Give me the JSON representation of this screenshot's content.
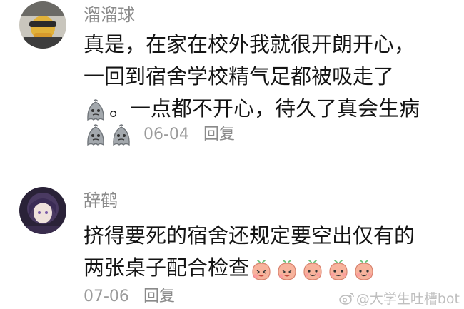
{
  "comments": [
    {
      "username": "溜溜球",
      "lines": [
        "真是，在家在校外我就很开朗开心，",
        "一回到宿舍学校精气足都被吸走了",
        "。一点都不开心，待久了真会生病"
      ],
      "line3_prefix_emoji": "tired-ghost-emoji",
      "trailing_emojis": [
        "tired-ghost-emoji",
        "tired-ghost-emoji"
      ],
      "date": "06-04",
      "reply_label": "回复"
    },
    {
      "username": "辞鹤",
      "lines": [
        "挤得要死的宿舍还规定要空出仅有的",
        "两张桌子配合检查"
      ],
      "trailing_emojis": [
        "peach-laugh-emoji",
        "peach-laugh-emoji",
        "peach-smile-emoji",
        "peach-smile-emoji",
        "peach-smile-emoji"
      ],
      "date": "07-06",
      "reply_label": "回复"
    }
  ],
  "watermark": {
    "text": "@大学生吐槽bot",
    "icon": "weibo-icon"
  },
  "colors": {
    "username": "#8b8b8b",
    "meta": "#9a9a9a",
    "ghost": "#9aa0a6",
    "peach": "#f6b09a",
    "leaf": "#6cc07a"
  }
}
